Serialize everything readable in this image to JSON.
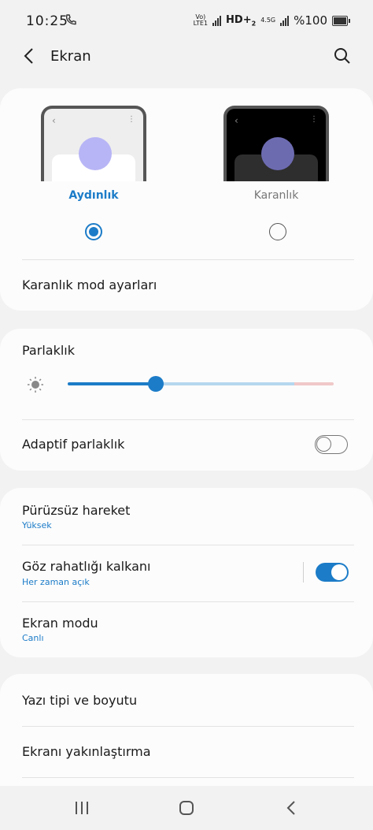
{
  "status_bar": {
    "time": "10:25",
    "call_icon": "wifi-calling-icon",
    "volte": "Vo)",
    "lte": "LTE1",
    "hd": "HD+",
    "sim": "2",
    "network": "4.5G",
    "battery": "%100"
  },
  "header": {
    "title": "Ekran",
    "back_icon": "back-chevron-icon",
    "search_icon": "search-icon"
  },
  "theme": {
    "light_label": "Aydınlık",
    "dark_label": "Karanlık",
    "selected": "light",
    "dark_mode_settings": "Karanlık mod ayarları"
  },
  "brightness": {
    "title": "Parlaklık",
    "level_percent": 33,
    "adaptive_label": "Adaptif parlaklık",
    "adaptive_on": false
  },
  "settings": {
    "smooth_motion": {
      "title": "Pürüzsüz hareket",
      "value": "Yüksek"
    },
    "eye_comfort": {
      "title": "Göz rahatlığı kalkanı",
      "value": "Her zaman açık",
      "on": true
    },
    "screen_mode": {
      "title": "Ekran modu",
      "value": "Canlı"
    },
    "font": {
      "title": "Yazı tipi ve boyutu"
    },
    "zoom": {
      "title": "Ekranı yakınlaştırma"
    }
  },
  "colors": {
    "accent": "#1c7cc8",
    "background": "#f2f2f2",
    "card": "#fcfcfc"
  },
  "nav_bar": {
    "recents_icon": "recents-icon",
    "home_icon": "home-icon",
    "back_icon": "back-icon"
  }
}
